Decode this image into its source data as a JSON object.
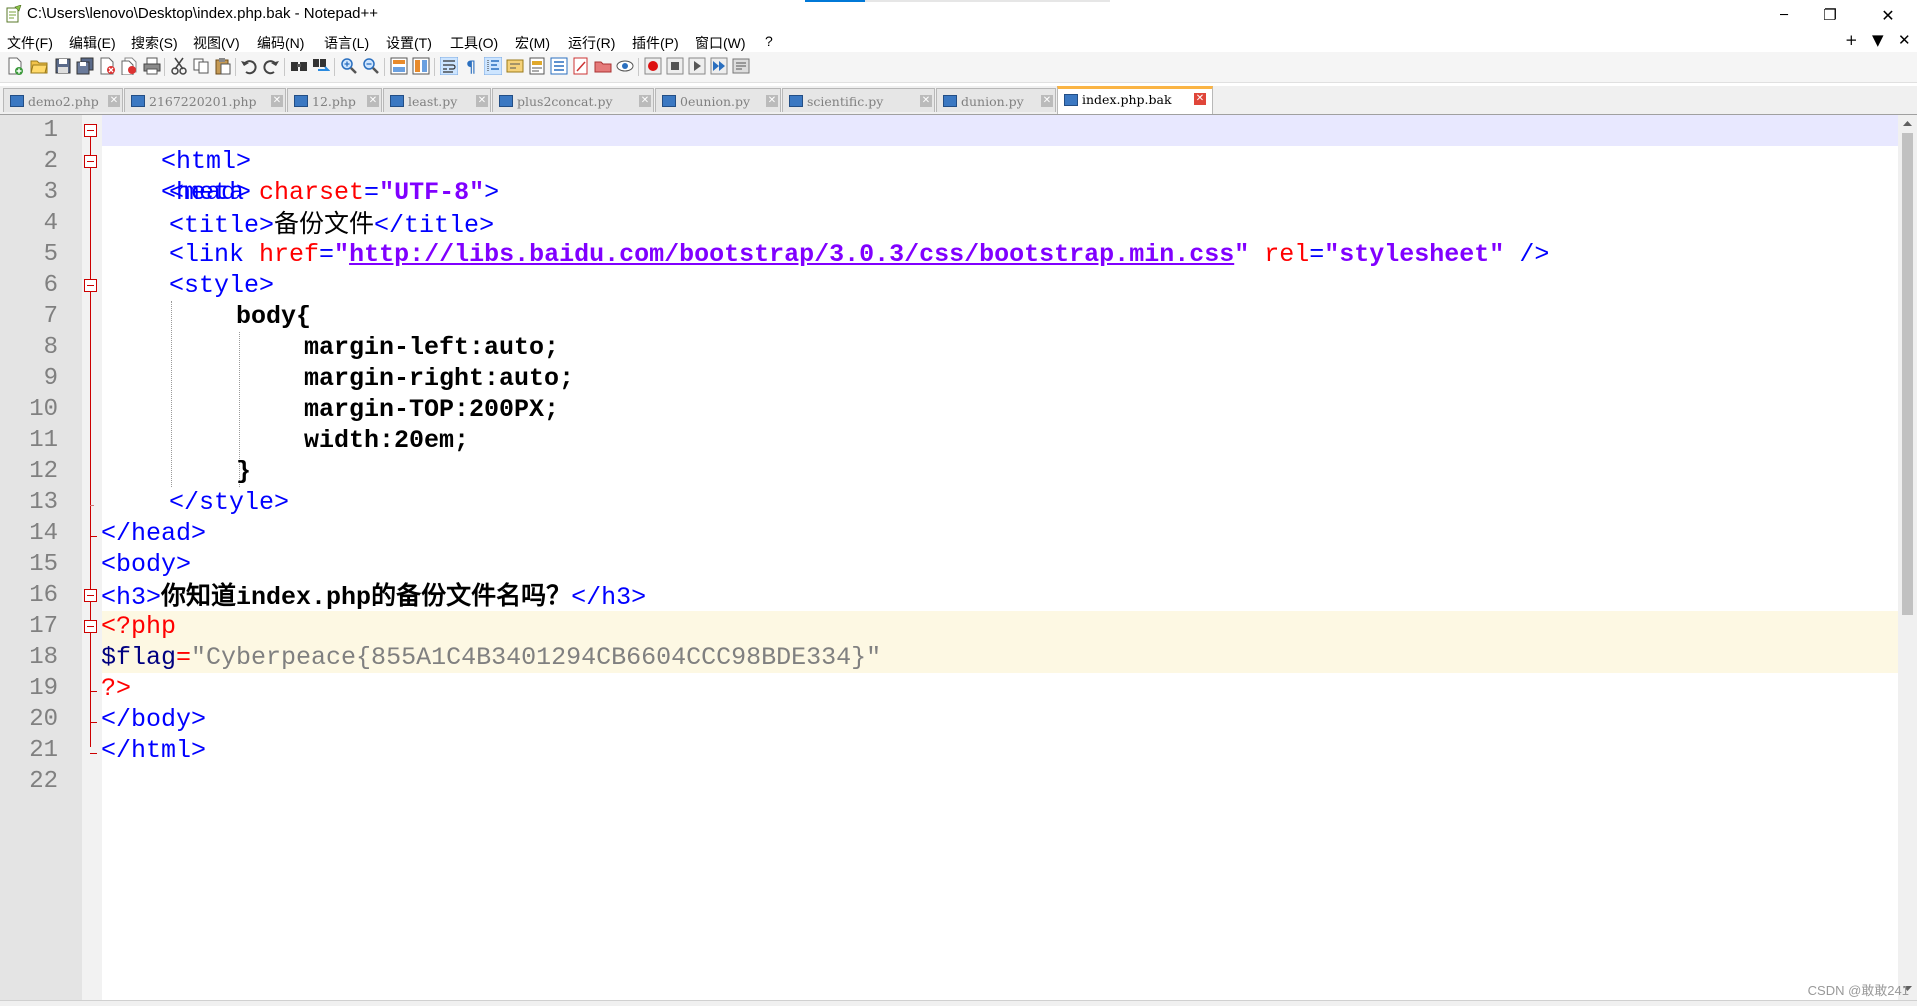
{
  "window": {
    "title": "C:\\Users\\lenovo\\Desktop\\index.php.bak - Notepad++",
    "minimize": "─",
    "restore": "❐",
    "close": "✕"
  },
  "menu": {
    "items": [
      "文件(F)",
      "编辑(E)",
      "搜索(S)",
      "视图(V)",
      "编码(N)",
      "语言(L)",
      "设置(T)",
      "工具(O)",
      "宏(M)",
      "运行(R)",
      "插件(P)",
      "窗口(W)",
      "?"
    ],
    "right": [
      "+",
      "▼",
      "✕"
    ]
  },
  "toolbar": {
    "icons": [
      "new-file-icon",
      "open-file-icon",
      "save-icon",
      "save-all-icon",
      "close-icon",
      "close-all-icon",
      "print-icon",
      "cut-icon",
      "copy-icon",
      "paste-icon",
      "undo-icon",
      "redo-icon",
      "find-icon",
      "replace-icon",
      "zoom-in-icon",
      "zoom-out-icon",
      "sync-vertical-icon",
      "sync-horizontal-icon",
      "word-wrap-icon",
      "show-all-chars-icon",
      "indent-guide-icon",
      "udl-icon",
      "doc-map-icon",
      "function-list-icon",
      "folder-workspace-icon",
      "monitoring-icon",
      "macro-record-icon",
      "macro-stop-icon",
      "macro-play-icon",
      "macro-run-multiple-icon",
      "macro-save-icon"
    ]
  },
  "tabs": [
    {
      "label": "demo2.php",
      "active": false
    },
    {
      "label": "2167220201.php",
      "active": false
    },
    {
      "label": "12.php",
      "active": false
    },
    {
      "label": "least.py",
      "active": false
    },
    {
      "label": "plus2concat.py",
      "active": false
    },
    {
      "label": "0eunion.py",
      "active": false
    },
    {
      "label": "scientific.py",
      "active": false
    },
    {
      "label": "dunion.py",
      "active": false
    },
    {
      "label": "index.php.bak",
      "active": true
    }
  ],
  "editor": {
    "line_numbers": [
      "1",
      "2",
      "3",
      "4",
      "5",
      "6",
      "7",
      "8",
      "9",
      "10",
      "11",
      "12",
      "13",
      "14",
      "15",
      "16",
      "17",
      "18",
      "19",
      "20",
      "21",
      "22"
    ],
    "code": {
      "l1_open": "<html>",
      "l2_open": "<head>",
      "l3_tag": "<meta ",
      "l3_attr": "charset",
      "l3_eq": "=",
      "l3_val": "\"UTF-8\"",
      "l3_end": ">",
      "l4_open": "<title>",
      "l4_text": "备份文件",
      "l4_close": "</title>",
      "l5_tag": "<link ",
      "l5_attr1": "href",
      "l5_eq1": "=",
      "l5_q1": "\"",
      "l5_url": "http://libs.baidu.com/bootstrap/3.0.3/css/bootstrap.min.css",
      "l5_q2": "\"",
      "l5_attr2": "rel",
      "l5_eq2": "=",
      "l5_val2": "\"stylesheet\"",
      "l5_end": " />",
      "l6_open": "<style>",
      "l7": "body{",
      "l8": "margin-left:auto;",
      "l9": "margin-right:auto;",
      "l10": "margin-TOP:200PX;",
      "l11": "width:20em;",
      "l12": "}",
      "l13": "</style>",
      "l14": "</head>",
      "l15": "<body>",
      "l16_open": "<h3>",
      "l16_t1": "你知道",
      "l16_t2": "index.php",
      "l16_t3": "的备份文件名吗？",
      "l16_close": "</h3>",
      "l17": "<?php",
      "l18_var": "$flag",
      "l18_eq": "=",
      "l18_str": "\"Cyberpeace{855A1C4B3401294CB6604CCC98BDE334}\"",
      "l19": "?>",
      "l20": "</body>",
      "l21": "</html>"
    }
  },
  "watermark": "CSDN @敢敢241",
  "colors": {
    "tag": "#0000ff",
    "attribute": "#ff0000",
    "attr_value": "#8000ff",
    "php_delim": "#ff0000",
    "php_string": "#808080",
    "current_line": "#e8e8ff",
    "fold_marker": "#cc0000",
    "active_tab_accent": "#fab444"
  }
}
